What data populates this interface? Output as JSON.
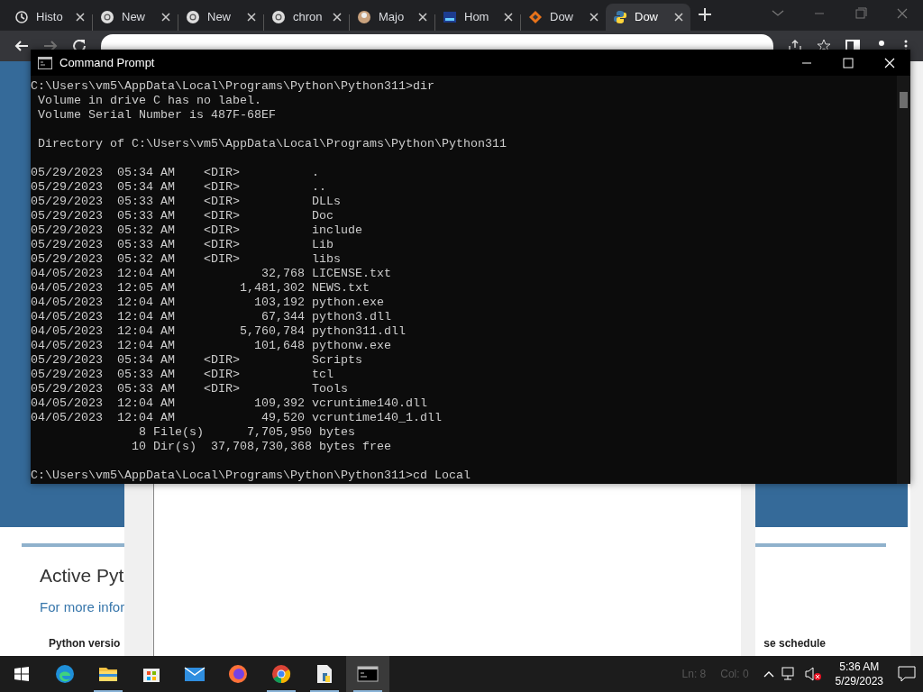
{
  "browser": {
    "tabs": [
      {
        "label": "Histo",
        "selected": false
      },
      {
        "label": "New",
        "selected": false
      },
      {
        "label": "New",
        "selected": false
      },
      {
        "label": "chron",
        "selected": false
      },
      {
        "label": "Majo",
        "selected": false
      },
      {
        "label": "Hom",
        "selected": false
      },
      {
        "label": "Dow",
        "selected": false
      },
      {
        "label": "Dow",
        "selected": true
      }
    ],
    "page": {
      "heading": "Active Pyt",
      "subtext": "For more infor",
      "column_1": "Python versio",
      "column_2": "se schedule"
    }
  },
  "terminal": {
    "title": "Command Prompt",
    "blocks": [
      {
        "lines": [
          "C:\\Users\\vm5\\AppData\\Local\\Programs\\Python\\Python311>dir",
          " Volume in drive C has no label.",
          " Volume Serial Number is 487F-68EF"
        ]
      },
      {
        "lines": [
          " Directory of C:\\Users\\vm5\\AppData\\Local\\Programs\\Python\\Python311"
        ]
      },
      {
        "lines": [
          "05/29/2023  05:34 AM    <DIR>          .",
          "05/29/2023  05:34 AM    <DIR>          ..",
          "05/29/2023  05:33 AM    <DIR>          DLLs",
          "05/29/2023  05:33 AM    <DIR>          Doc",
          "05/29/2023  05:32 AM    <DIR>          include",
          "05/29/2023  05:33 AM    <DIR>          Lib",
          "05/29/2023  05:32 AM    <DIR>          libs",
          "04/05/2023  12:04 AM            32,768 LICENSE.txt",
          "04/05/2023  12:05 AM         1,481,302 NEWS.txt",
          "04/05/2023  12:04 AM           103,192 python.exe",
          "04/05/2023  12:04 AM            67,344 python3.dll",
          "04/05/2023  12:04 AM         5,760,784 python311.dll",
          "04/05/2023  12:04 AM           101,648 pythonw.exe",
          "05/29/2023  05:34 AM    <DIR>          Scripts",
          "05/29/2023  05:33 AM    <DIR>          tcl",
          "05/29/2023  05:33 AM    <DIR>          Tools",
          "04/05/2023  12:04 AM           109,392 vcruntime140.dll",
          "04/05/2023  12:04 AM            49,520 vcruntime140_1.dll",
          "               8 File(s)      7,705,950 bytes",
          "              10 Dir(s)  37,708,730,368 bytes free"
        ]
      },
      {
        "lines": [
          "C:\\Users\\vm5\\AppData\\Local\\Programs\\Python\\Python311>cd Local"
        ]
      }
    ]
  },
  "taskbar": {
    "apps": [
      {
        "kind": "edge",
        "running": false,
        "selected": false
      },
      {
        "kind": "explorer",
        "running": true,
        "selected": false
      },
      {
        "kind": "store",
        "running": false,
        "selected": false
      },
      {
        "kind": "mail",
        "running": false,
        "selected": false
      },
      {
        "kind": "firefox",
        "running": false,
        "selected": false
      },
      {
        "kind": "chrome",
        "running": true,
        "selected": false
      },
      {
        "kind": "pyfile",
        "running": true,
        "selected": false
      },
      {
        "kind": "cmd",
        "running": true,
        "selected": true
      }
    ],
    "behind_status": [
      "Ln: 8",
      "Col: 0"
    ],
    "time": "5:36 AM",
    "date": "5/29/2023"
  }
}
